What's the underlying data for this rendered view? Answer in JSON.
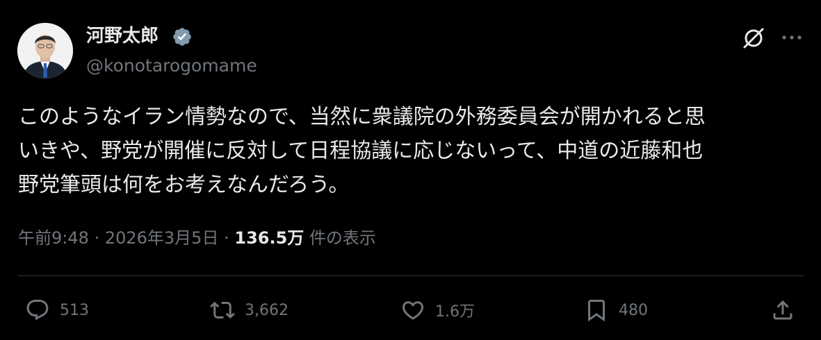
{
  "author": {
    "display_name": "河野太郎",
    "handle": "@konotarogomame",
    "verified": true
  },
  "tweet": {
    "text": "このようなイラン情勢なので、当然に衆議院の外務委員会が開かれると思\nいきや、野党が開催に反対して日程協議に応じないって、中道の近藤和也\n野党筆頭は何をお考えなんだろう。"
  },
  "meta": {
    "time": "午前9:48",
    "separator": "·",
    "date": "2026年3月5日",
    "views_count": "136.5万",
    "views_label": "件の表示"
  },
  "actions": {
    "replies": "513",
    "retweets": "3,662",
    "likes": "1.6万",
    "bookmarks": "480"
  },
  "icons": [
    "verified-badge-icon",
    "grok-icon",
    "more-icon",
    "reply-icon",
    "retweet-icon",
    "like-icon",
    "bookmark-icon",
    "share-icon"
  ],
  "colors": {
    "background": "#000000",
    "text": "#e7e9ea",
    "muted": "#71767b",
    "divider": "#2f3336",
    "verified_badge": "#829aab"
  }
}
